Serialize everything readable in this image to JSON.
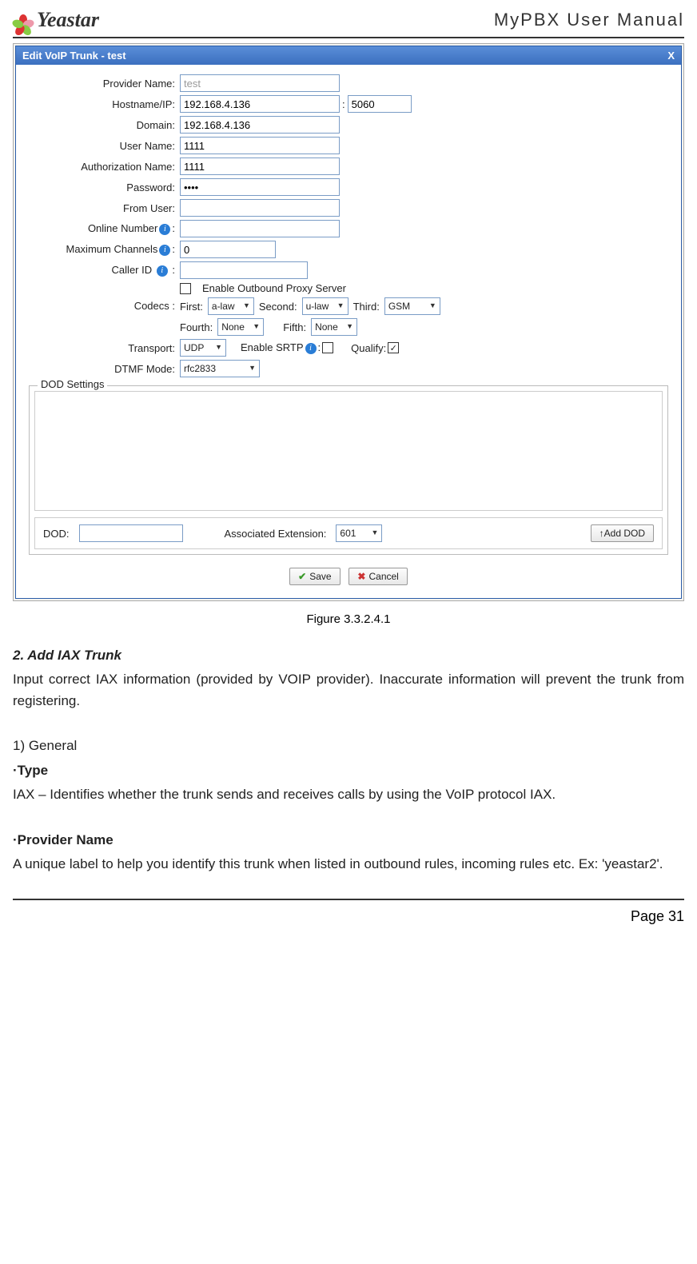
{
  "header": {
    "brand": "Yeastar",
    "title": "MyPBX User Manual"
  },
  "dialog": {
    "title": "Edit VoIP Trunk - test",
    "close": "X",
    "fields": {
      "provider_name_label": "Provider Name:",
      "provider_name_value": "test",
      "hostname_label": "Hostname/IP:",
      "hostname_value": "192.168.4.136",
      "port_sep": ":",
      "port_value": "5060",
      "domain_label": "Domain:",
      "domain_value": "192.168.4.136",
      "username_label": "User Name:",
      "username_value": "1111",
      "authname_label": "Authorization Name:",
      "authname_value": "1111",
      "password_label": "Password:",
      "password_value": "••••",
      "fromuser_label": "From User:",
      "fromuser_value": "",
      "online_label_pre": "Online Number",
      "online_label_post": ":",
      "online_value": "",
      "maxch_label_pre": "Maximum Channels",
      "maxch_label_post": ":",
      "maxch_value": "0",
      "callerid_label_pre": "Caller ID",
      "callerid_label_post": ":",
      "callerid_value": "",
      "enable_proxy_label": "Enable Outbound Proxy Server",
      "codecs_label": "Codecs :",
      "codec_first_label": "First:",
      "codec_first_value": "a-law",
      "codec_second_label": "Second:",
      "codec_second_value": "u-law",
      "codec_third_label": "Third:",
      "codec_third_value": "GSM",
      "codec_fourth_label": "Fourth:",
      "codec_fourth_value": "None",
      "codec_fifth_label": "Fifth:",
      "codec_fifth_value": "None",
      "transport_label": "Transport:",
      "transport_value": "UDP",
      "enable_srtp_label_pre": "Enable SRTP",
      "enable_srtp_label_post": ":",
      "qualify_label": "Qualify:",
      "qualify_checked": "✓",
      "dtmf_label": "DTMF Mode:",
      "dtmf_value": "rfc2833"
    },
    "dod": {
      "legend": "DOD Settings",
      "dod_label": "DOD:",
      "dod_value": "",
      "assoc_label": "Associated Extension:",
      "assoc_value": "601",
      "add_btn": "↑Add DOD"
    },
    "footer": {
      "save": "Save",
      "cancel": "Cancel"
    }
  },
  "caption": "Figure 3.3.2.4.1",
  "body": {
    "h1": "2. Add IAX Trunk",
    "p1": "Input correct IAX information (provided by VOIP provider). Inaccurate information will prevent the trunk from registering.",
    "h2": "1) General",
    "h3": "·Type",
    "p2": "IAX – Identifies whether the trunk sends and receives calls by using the VoIP protocol IAX.",
    "h4": "·Provider Name",
    "p3": "A unique label to help you identify this trunk when listed in outbound rules, incoming rules etc. Ex: 'yeastar2'."
  },
  "footer": {
    "page": "Page 31"
  }
}
